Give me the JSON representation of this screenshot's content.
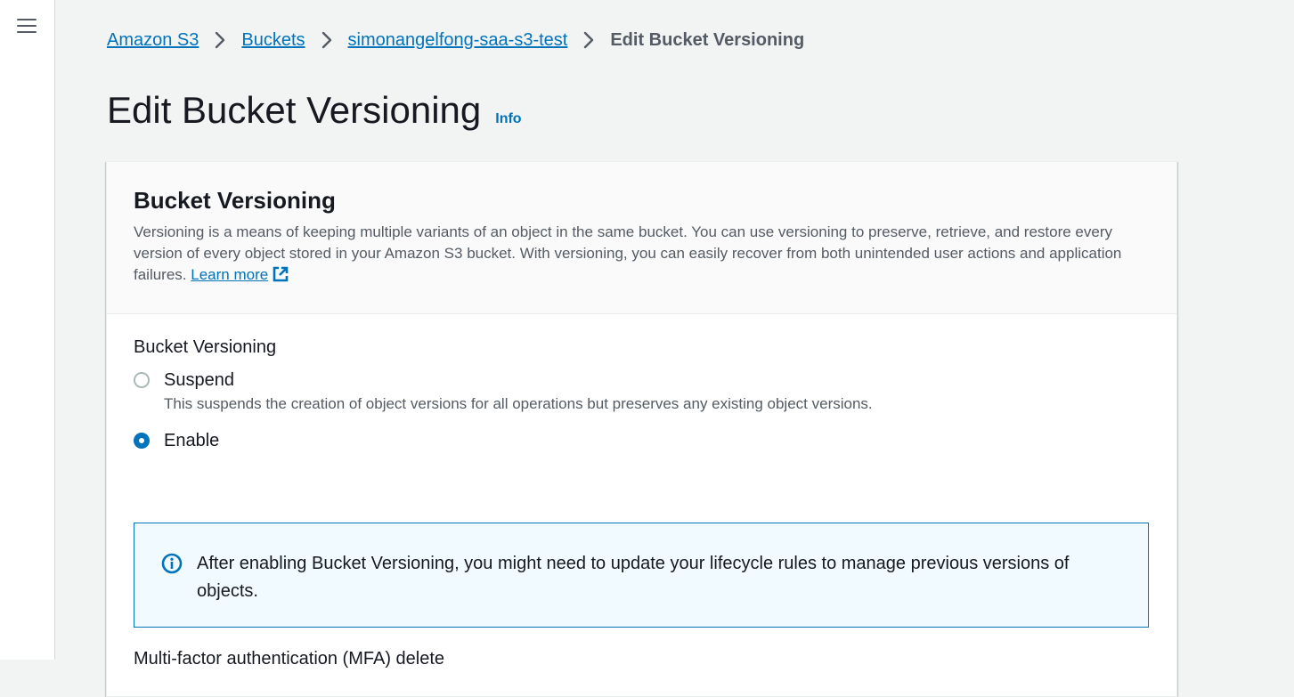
{
  "breadcrumb": {
    "items": [
      "Amazon S3",
      "Buckets",
      "simonangelfong-saa-s3-test"
    ],
    "current": "Edit Bucket Versioning"
  },
  "page": {
    "title": "Edit Bucket Versioning",
    "info_link": "Info"
  },
  "section": {
    "title": "Bucket Versioning",
    "description": "Versioning is a means of keeping multiple variants of an object in the same bucket. You can use versioning to preserve, retrieve, and restore every version of every object stored in your Amazon S3 bucket. With versioning, you can easily recover from both unintended user actions and application failures.",
    "learn_more": "Learn more"
  },
  "versioning_field": {
    "label": "Bucket Versioning",
    "options": [
      {
        "label": "Suspend",
        "description": "This suspends the creation of object versions for all operations but preserves any existing object versions.",
        "selected": false
      },
      {
        "label": "Enable",
        "description": "",
        "selected": true
      }
    ]
  },
  "alert": {
    "text": "After enabling Bucket Versioning, you might need to update your lifecycle rules to manage previous versions of objects."
  },
  "mfa": {
    "label": "Multi-factor authentication (MFA) delete"
  },
  "colors": {
    "link": "#0073bb",
    "alert_bg": "#f1faff",
    "page_bg": "#f2f3f3"
  }
}
